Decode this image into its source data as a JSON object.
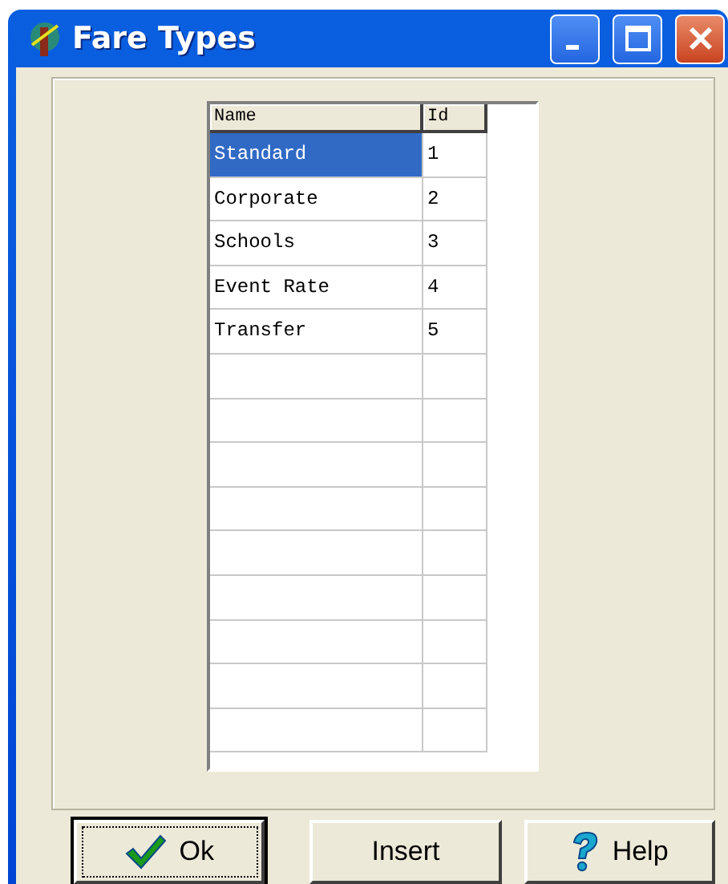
{
  "window": {
    "title": "Fare Types"
  },
  "table": {
    "columns": [
      "Name",
      "Id"
    ],
    "rows": [
      {
        "name": "Standard",
        "id": "1",
        "selected": true
      },
      {
        "name": "Corporate",
        "id": "2",
        "selected": false
      },
      {
        "name": "Schools",
        "id": "3",
        "selected": false
      },
      {
        "name": "Event Rate",
        "id": "4",
        "selected": false
      },
      {
        "name": "Transfer",
        "id": "5",
        "selected": false
      }
    ]
  },
  "buttons": [
    {
      "kind": "ok",
      "label": "Ok",
      "focused": true
    },
    {
      "kind": "plain",
      "label": "Insert",
      "focused": false
    },
    {
      "kind": "help",
      "label": "Help",
      "focused": false
    }
  ]
}
